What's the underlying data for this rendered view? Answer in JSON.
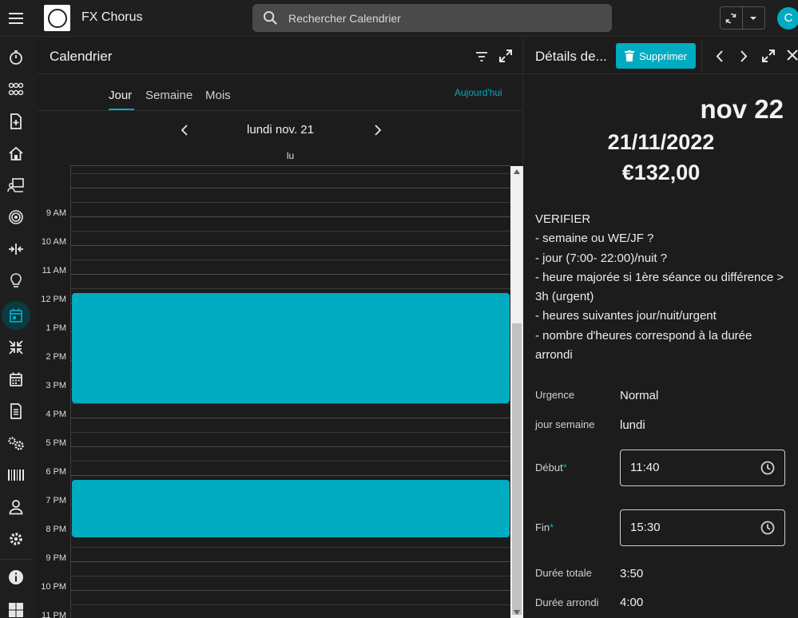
{
  "topbar": {
    "app_name": "FX Chorus",
    "search_placeholder": "Rechercher Calendrier",
    "avatar_initial": "C"
  },
  "rail": {
    "items": [
      "timer-icon",
      "users-icon",
      "add-document-icon",
      "home-icon",
      "presentation-icon",
      "target-icon",
      "compress-icon",
      "lightbulb-icon",
      "calendar-icon",
      "collapse-arrows-icon",
      "calendar-grid-icon",
      "receipt-icon",
      "gears-icon",
      "barcode-icon",
      "person-icon",
      "settings-icon",
      "info-icon",
      "windows-icon"
    ],
    "active": "calendar-icon"
  },
  "calendar": {
    "title": "Calendrier",
    "tabs": [
      "Jour",
      "Semaine",
      "Mois"
    ],
    "active_tab": "Jour",
    "today_label": "Aujourd'hui",
    "date_label": "lundi nov. 21",
    "day_header": "lu",
    "hour_labels": [
      "",
      "9 AM",
      "10 AM",
      "11 AM",
      "12 PM",
      "1 PM",
      "2 PM",
      "3 PM",
      "4 PM",
      "5 PM",
      "6 PM",
      "7 PM",
      "8 PM",
      "9 PM",
      "10 PM",
      "11 PM"
    ],
    "events": [
      {
        "name": "event-1",
        "start": "11:40",
        "end": "15:30",
        "color": "#00acc1"
      },
      {
        "name": "event-2",
        "start": "18:10",
        "end": "20:10",
        "color": "#00acc1"
      }
    ]
  },
  "details": {
    "title": "Détails de...",
    "delete_label": "Supprimer",
    "month_day": "nov 22",
    "date": "21/11/2022",
    "amount": "€132,00",
    "notes": [
      "VERIFIER",
      "- semaine ou WE/JF ?",
      "- jour (7:00- 22:00)/nuit ?",
      "- heure majorée si 1ère séance ou différence > 3h (urgent)",
      "- heures suivantes jour/nuit/urgent",
      "- nombre d'heures correspond à la durée arrondi"
    ],
    "urgence_label": "Urgence",
    "urgence_value": "Normal",
    "jour_label": "jour semaine",
    "jour_value": "lundi",
    "debut_label": "Début",
    "debut_value": "11:40",
    "fin_label": "Fin",
    "fin_value": "15:30",
    "duree_totale_label": "Durée totale",
    "duree_totale_value": "3:50",
    "duree_arrondi_label": "Durée arrondi",
    "duree_arrondi_value": "4:00",
    "required_mark": "*"
  },
  "colors": {
    "accent": "#00acc1",
    "background": "#1c1c1c"
  }
}
